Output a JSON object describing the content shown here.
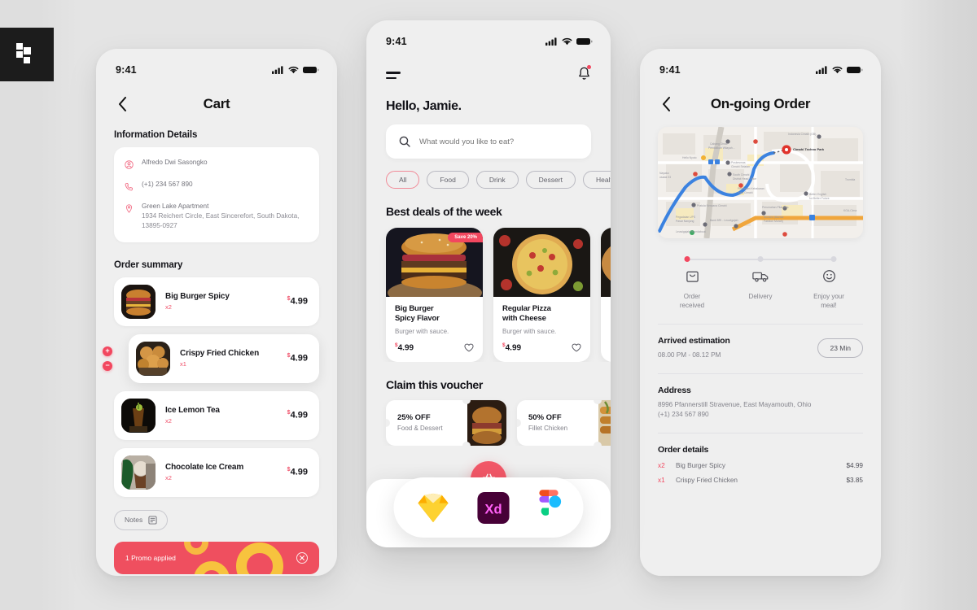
{
  "brand": {
    "logo_icon": "brand-mark-icon"
  },
  "colors": {
    "accent_red": "#f2475f",
    "promo_bg": "#ef4f5f",
    "promo_ring_yellow": "#f7c33e",
    "fab": "#f15767",
    "page_bg": "#e2e2e2",
    "phone_bg": "#efefef",
    "card_white": "#ffffff",
    "text_dark": "#15151a",
    "text_muted": "#83838b"
  },
  "cart_screen": {
    "status": {
      "time": "9:41",
      "signal_icon": "cellular-signal-icon",
      "wifi_icon": "wifi-icon",
      "battery_icon": "battery-full-icon"
    },
    "back_icon": "chevron-left-icon",
    "title": "Cart",
    "information_section_title": "Information Details",
    "information": {
      "name": "Alfredo Dwi Sasongko",
      "name_icon": "user-circle-icon",
      "phone": "(+1) 234 567 890",
      "phone_icon": "phone-icon",
      "address_icon": "location-pin-icon",
      "address_name": "Green Lake Apartment",
      "address_detail": "1934 Reichert Circle, East Sincerefort, South Dakota, 13895-0927"
    },
    "order_section_title": "Order summary",
    "items": [
      {
        "name": "Big Burger Spicy",
        "qty": "x2",
        "currency": "$",
        "price": "4.99",
        "thumb": "burger-thumb"
      },
      {
        "name": "Crispy Fried Chicken",
        "qty": "x1",
        "currency": "$",
        "price": "4.99",
        "thumb": "fried-chicken-thumb",
        "focused": true,
        "increase_label": "+",
        "decrease_label": "−"
      },
      {
        "name": "Ice Lemon Tea",
        "qty": "x2",
        "currency": "$",
        "price": "4.99",
        "thumb": "ice-lemon-tea-thumb"
      },
      {
        "name": "Chocolate Ice Cream",
        "qty": "x2",
        "currency": "$",
        "price": "4.99",
        "thumb": "ice-cream-thumb"
      }
    ],
    "notes_label": "Notes",
    "notes_icon": "note-edit-icon",
    "promo_label": "1 Promo applied",
    "promo_close_icon": "close-circle-icon"
  },
  "home_screen": {
    "status": {
      "time": "9:41",
      "signal_icon": "cellular-signal-icon",
      "wifi_icon": "wifi-icon",
      "battery_icon": "battery-full-icon"
    },
    "menu_icon": "hamburger-menu-icon",
    "notification_icon": "bell-icon",
    "greeting": "Hello, Jamie.",
    "search": {
      "placeholder": "What would you like to eat?",
      "value": "",
      "icon": "search-icon"
    },
    "categories": [
      {
        "label": "All",
        "active": true
      },
      {
        "label": "Food",
        "active": false
      },
      {
        "label": "Drink",
        "active": false
      },
      {
        "label": "Dessert",
        "active": false
      },
      {
        "label": "Healthy",
        "active": false
      }
    ],
    "deals_title": "Best deals of the week",
    "deals": [
      {
        "name": "Big Burger\nSpicy Flavor",
        "name_line1": "Big Burger",
        "name_line2": "Spicy Flavor",
        "desc": "Burger with sauce.",
        "currency": "$",
        "price": "4.99",
        "badge": "Save 20%",
        "favorite_icon": "heart-outline-icon",
        "image": "burger-photo"
      },
      {
        "name": "Regular Pizza\nwith Cheese",
        "name_line1": "Regular Pizza",
        "name_line2": "with Cheese",
        "desc": "Burger with sauce.",
        "currency": "$",
        "price": "4.99",
        "badge": "",
        "favorite_icon": "heart-outline-icon",
        "image": "pizza-photo"
      },
      {
        "name_line1": "",
        "name_line2": "",
        "desc": "",
        "currency": "",
        "price": "",
        "badge": "",
        "image": "grill-photo"
      }
    ],
    "voucher_title": "Claim this  voucher",
    "vouchers": [
      {
        "off": "25% OFF",
        "for": "Food & Dessert",
        "image": "burger-voucher-photo"
      },
      {
        "off": "50% OFF",
        "for": "Fillet Chicken",
        "image": "chicken-voucher-photo"
      }
    ],
    "bottom_nav": [
      {
        "icon": "home-icon",
        "active": true
      },
      {
        "icon": "bookmark-add-icon",
        "active": false
      },
      {
        "icon": "history-clock-icon",
        "active": false
      },
      {
        "icon": "user-account-icon",
        "active": false
      }
    ],
    "fab_icon": "shopping-basket-icon",
    "tools": [
      {
        "name": "sketch-logo-icon"
      },
      {
        "name": "adobe-xd-logo-icon"
      },
      {
        "name": "figma-logo-icon"
      }
    ]
  },
  "order_screen": {
    "status": {
      "time": "9:41",
      "signal_icon": "cellular-signal-icon",
      "wifi_icon": "wifi-icon",
      "battery_icon": "battery-full-icon"
    },
    "back_icon": "chevron-left-icon",
    "title": "On-going Order",
    "map": {
      "destination_label": "Cimahi Techno Park",
      "labels": [
        "Indonesia Cimahi (GB)...",
        "Cabang Dinas Pendidikan Wilayah...",
        "Hello Nyoto",
        "Puskesmas Cimahi Selatan",
        "Nayaka Husada 03",
        "South Cimahi District Head Office",
        "Pemadam Kebakaran Kota Cimahi",
        "Pratula Kencana Cimahi",
        "Perumahan Pilar Mas",
        "Better English for Better Future",
        "Pegadaian UPS Pasar Nanjung",
        "Bank BRI - Leuwigajah",
        "Stockist (Bazaar Fashion Murah)",
        "Leuwigajah Roundabout"
      ]
    },
    "tracker": {
      "steps": [
        {
          "label": "Order\nreceived",
          "label_line1": "Order",
          "label_line2": "received",
          "icon": "bag-smile-icon",
          "done": true
        },
        {
          "label": "Delivery",
          "label_line1": "Delivery",
          "label_line2": "",
          "icon": "delivery-truck-icon",
          "done": false
        },
        {
          "label": "Enjoy your\nmeal!",
          "label_line1": "Enjoy your",
          "label_line2": "meal!",
          "icon": "smile-face-icon",
          "done": false
        }
      ]
    },
    "arrived": {
      "title": "Arrived estimation",
      "range": "08.00 PM - 08.12 PM",
      "duration": "23 Min"
    },
    "address": {
      "title": "Address",
      "line1": "8996 Pfannerstill Stravenue, East Mayamouth, Ohio",
      "line2": "(+1) 234 567 890"
    },
    "order_details": {
      "title": "Order details",
      "items": [
        {
          "qty": "x2",
          "name": "Big Burger Spicy",
          "price": "$4.99"
        },
        {
          "qty": "x1",
          "name": "Crispy Fried Chicken",
          "price": "$3.85"
        }
      ]
    }
  }
}
